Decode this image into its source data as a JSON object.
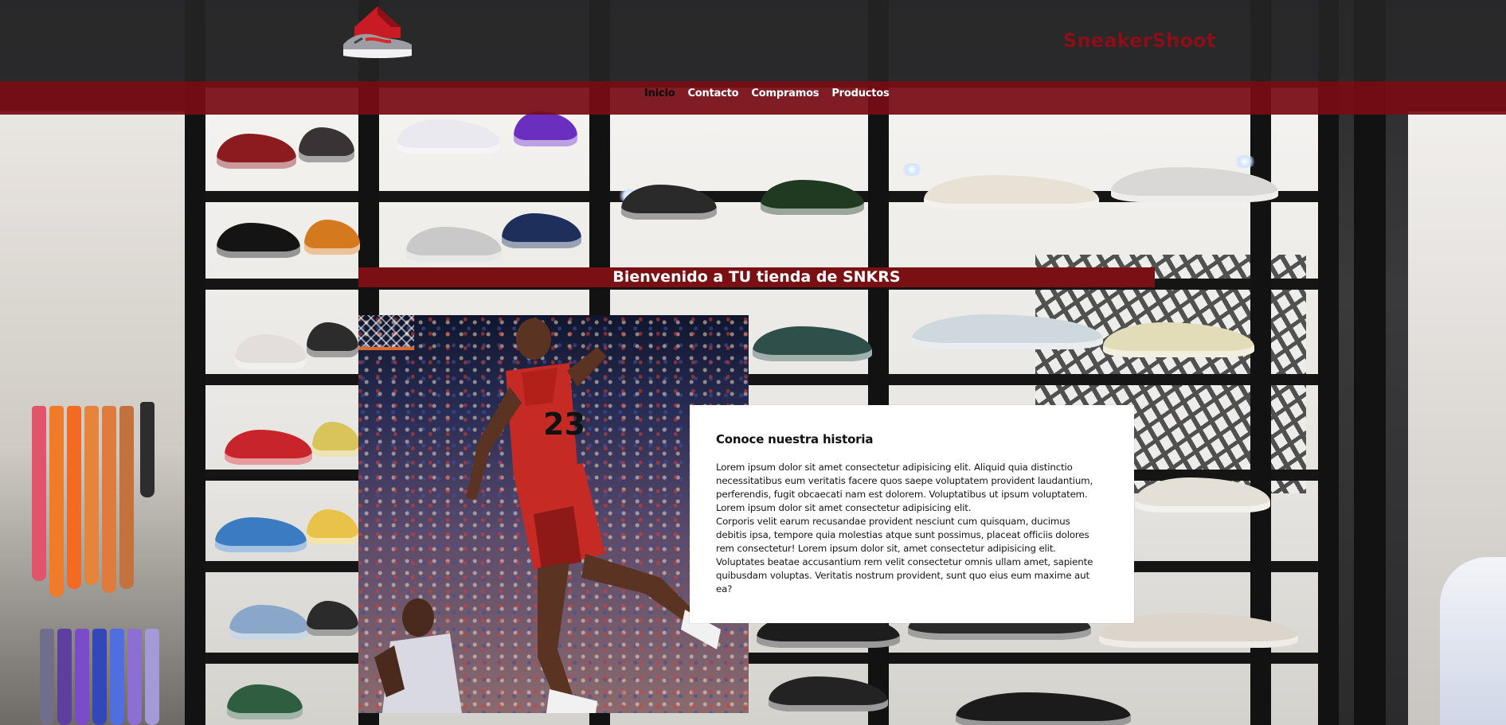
{
  "header": {
    "brand": "SneakerShoot",
    "logo_icon": "red-house-sneaker-logo-icon"
  },
  "nav": {
    "items": [
      {
        "label": "Inicio",
        "active": true
      },
      {
        "label": "Contacto",
        "active": false
      },
      {
        "label": "Compramos",
        "active": false
      },
      {
        "label": "Productos",
        "active": false
      }
    ]
  },
  "hero": {
    "banner": "Bienvenido a TU tienda de SNKRS"
  },
  "story": {
    "title": "Conoce nuestra historia",
    "body": "Lorem ipsum dolor sit amet consectetur adipisicing elit. Aliquid quia distinctio\nnecessitatibus eum veritatis facere quos saepe voluptatem provident laudantium,\nperferendis, fugit obcaecati nam est dolorem. Voluptatibus ut ipsum voluptatem.\nLorem ipsum dolor sit amet consectetur adipisicing elit.\nCorporis velit earum recusandae provident nesciunt cum quisquam, ducimus\ndebitis ipsa, tempore quia molestias atque sunt possimus, placeat officiis dolores\nrem consectetur! Lorem ipsum dolor sit, amet consectetur adipisicing elit.\nVoluptates beatae accusantium rem velit consectetur omnis ullam amet, sapiente\nquibusdam voluptas. Veritatis nostrum provident, sunt quo eius eum maxime aut\nea?"
  },
  "theme": {
    "accent": "#7a1014",
    "brand_color": "#8a0f17",
    "nav_bg": "#760c14",
    "header_bg": "#28282a"
  },
  "images": {
    "background": "sneaker-store-shelves-image",
    "photo": "basketball-dunk-photo"
  }
}
